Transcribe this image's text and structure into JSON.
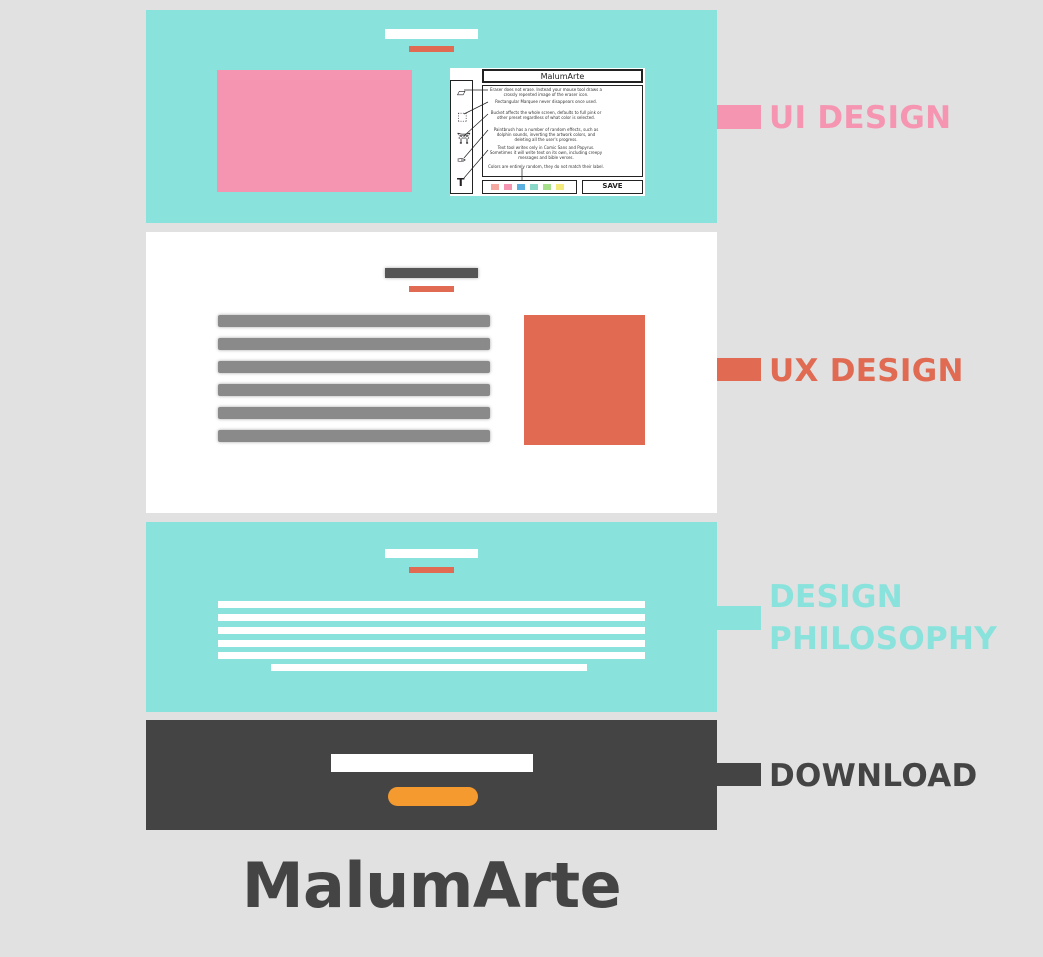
{
  "colors": {
    "background": "#e1e1e1",
    "teal": "#89e2dc",
    "pink": "#f595b2",
    "coral": "#e06a52",
    "dark": "#444444",
    "orange": "#f59a2f",
    "white": "#ffffff"
  },
  "sections": [
    {
      "id": "ui-design",
      "label": "UI DESIGN",
      "label_color": "#f595b2"
    },
    {
      "id": "ux-design",
      "label": "UX DESIGN",
      "label_color": "#e06a52"
    },
    {
      "id": "design-philosophy",
      "label_line1": "DESIGN",
      "label_line2": "PHILOSOPHY",
      "label_color": "#89e2dc"
    },
    {
      "id": "download",
      "label": "DOWNLOAD",
      "label_color": "#444444"
    }
  ],
  "wireframe": {
    "title": "MalumArte",
    "save_label": "SAVE",
    "tools": [
      "eraser-icon",
      "select-icon",
      "bucket-icon",
      "brush-icon",
      "text-icon"
    ],
    "text_tool_glyph": "T",
    "notes": [
      "Eraser does not erase. Instead your mouse tool draws a crossly repented image of the eraser icon.",
      "Rectangular Marquee never disappears once used.",
      "Bucket affects the whole screen, defaults to full pink or other preset regardless of what color is selected.",
      "Paintbrush has a number of random effects, such as dolphin sounds, inverting the artwork colors, and deleting all the user's progress.",
      "Text tool writes only in Comic Sans and Papyrus. Sometimes it will write text on its own, including creepy messages and bible verses.",
      "Colors are entirely random, they do not match their label."
    ],
    "swatches": [
      "#f5a9a0",
      "#f595b2",
      "#5ab0e0",
      "#8ad8c8",
      "#a6e08a",
      "#f3ea7a"
    ]
  },
  "footer": {
    "app_name": "MalumArte"
  }
}
